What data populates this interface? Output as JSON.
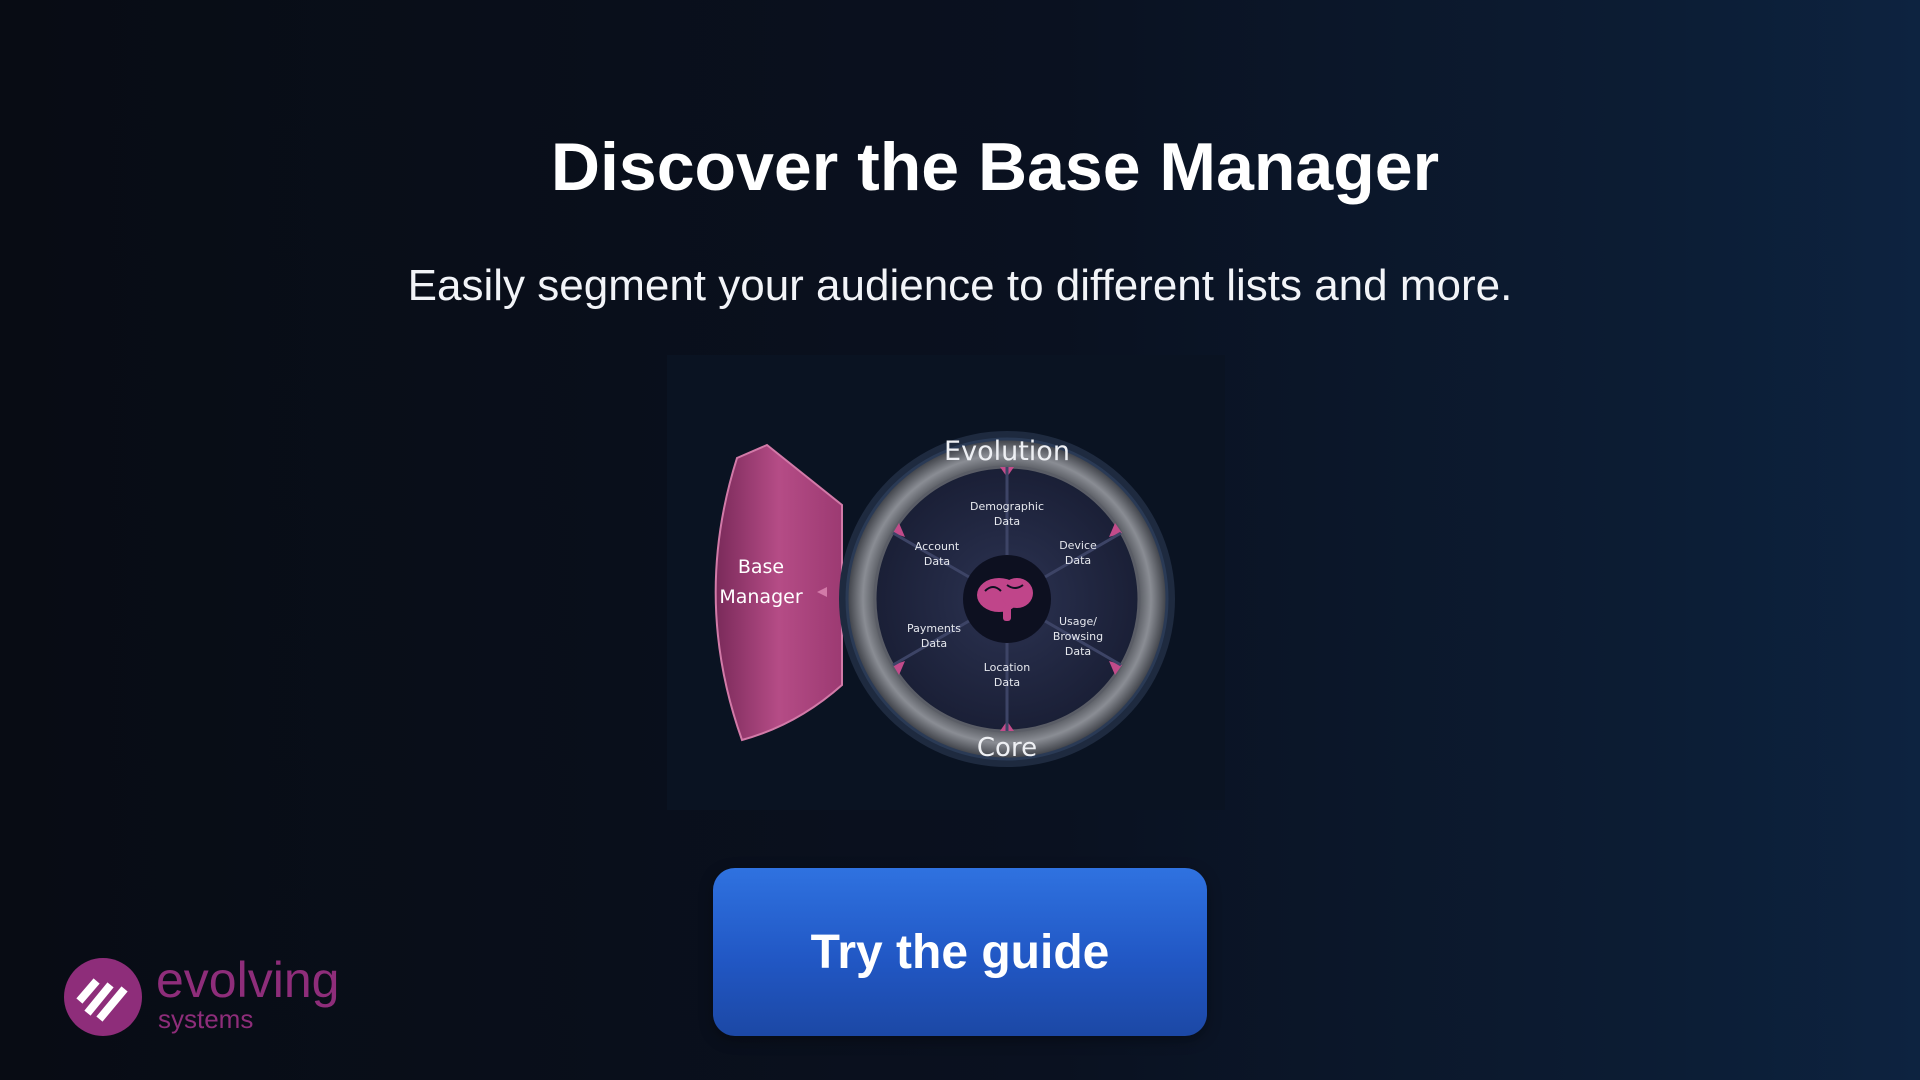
{
  "page": {
    "title": "Discover the Base Manager",
    "subtitle": "Easily segment your audience to different lists and more."
  },
  "diagram": {
    "outer_ring_top": "Evolution",
    "outer_ring_bottom": "Core",
    "side_block_line1": "Base",
    "side_block_line2": "Manager",
    "segments": [
      {
        "line1": "Demographic",
        "line2": "Data",
        "line3": ""
      },
      {
        "line1": "Device",
        "line2": "Data",
        "line3": ""
      },
      {
        "line1": "Usage/",
        "line2": "Browsing",
        "line3": "Data"
      },
      {
        "line1": "Location",
        "line2": "Data",
        "line3": ""
      },
      {
        "line1": "Payments",
        "line2": "Data",
        "line3": ""
      },
      {
        "line1": "Account",
        "line2": "Data",
        "line3": ""
      }
    ],
    "center_icon": "brain-icon"
  },
  "cta": {
    "label": "Try the guide"
  },
  "logo": {
    "wordmark": "evolving",
    "subword": "systems",
    "mark_icon": "evolving-systems-logo-icon"
  },
  "colors": {
    "accent_pink": "#b2467f",
    "button_blue": "#2561d4",
    "logo_purple": "#8e2d7a",
    "ring_gray": "#6e7178"
  }
}
